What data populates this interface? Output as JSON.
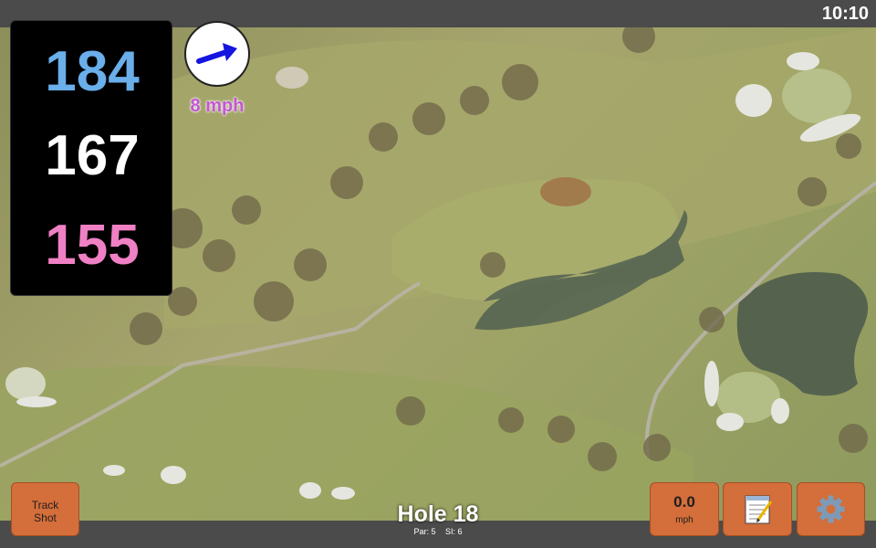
{
  "status_bar": {
    "time": "10:10"
  },
  "distances": {
    "back": "184",
    "middle": "167",
    "front": "155"
  },
  "wind": {
    "speed_text": "8 mph",
    "icon": "wind-arrow-icon"
  },
  "hole": {
    "title": "Hole 18",
    "par": "Par: 5",
    "si": "SI: 6"
  },
  "buttons": {
    "track_shot_line1": "Track",
    "track_shot_line2": "Shot",
    "speed_value": "0.0",
    "speed_unit": "mph",
    "notes_icon": "notepad-icon",
    "settings_icon": "gear-icon"
  },
  "colors": {
    "back": "#6aaeea",
    "middle": "#ffffff",
    "front": "#f080c4",
    "button": "#d46e3a",
    "wind_text": "#c455d4"
  }
}
